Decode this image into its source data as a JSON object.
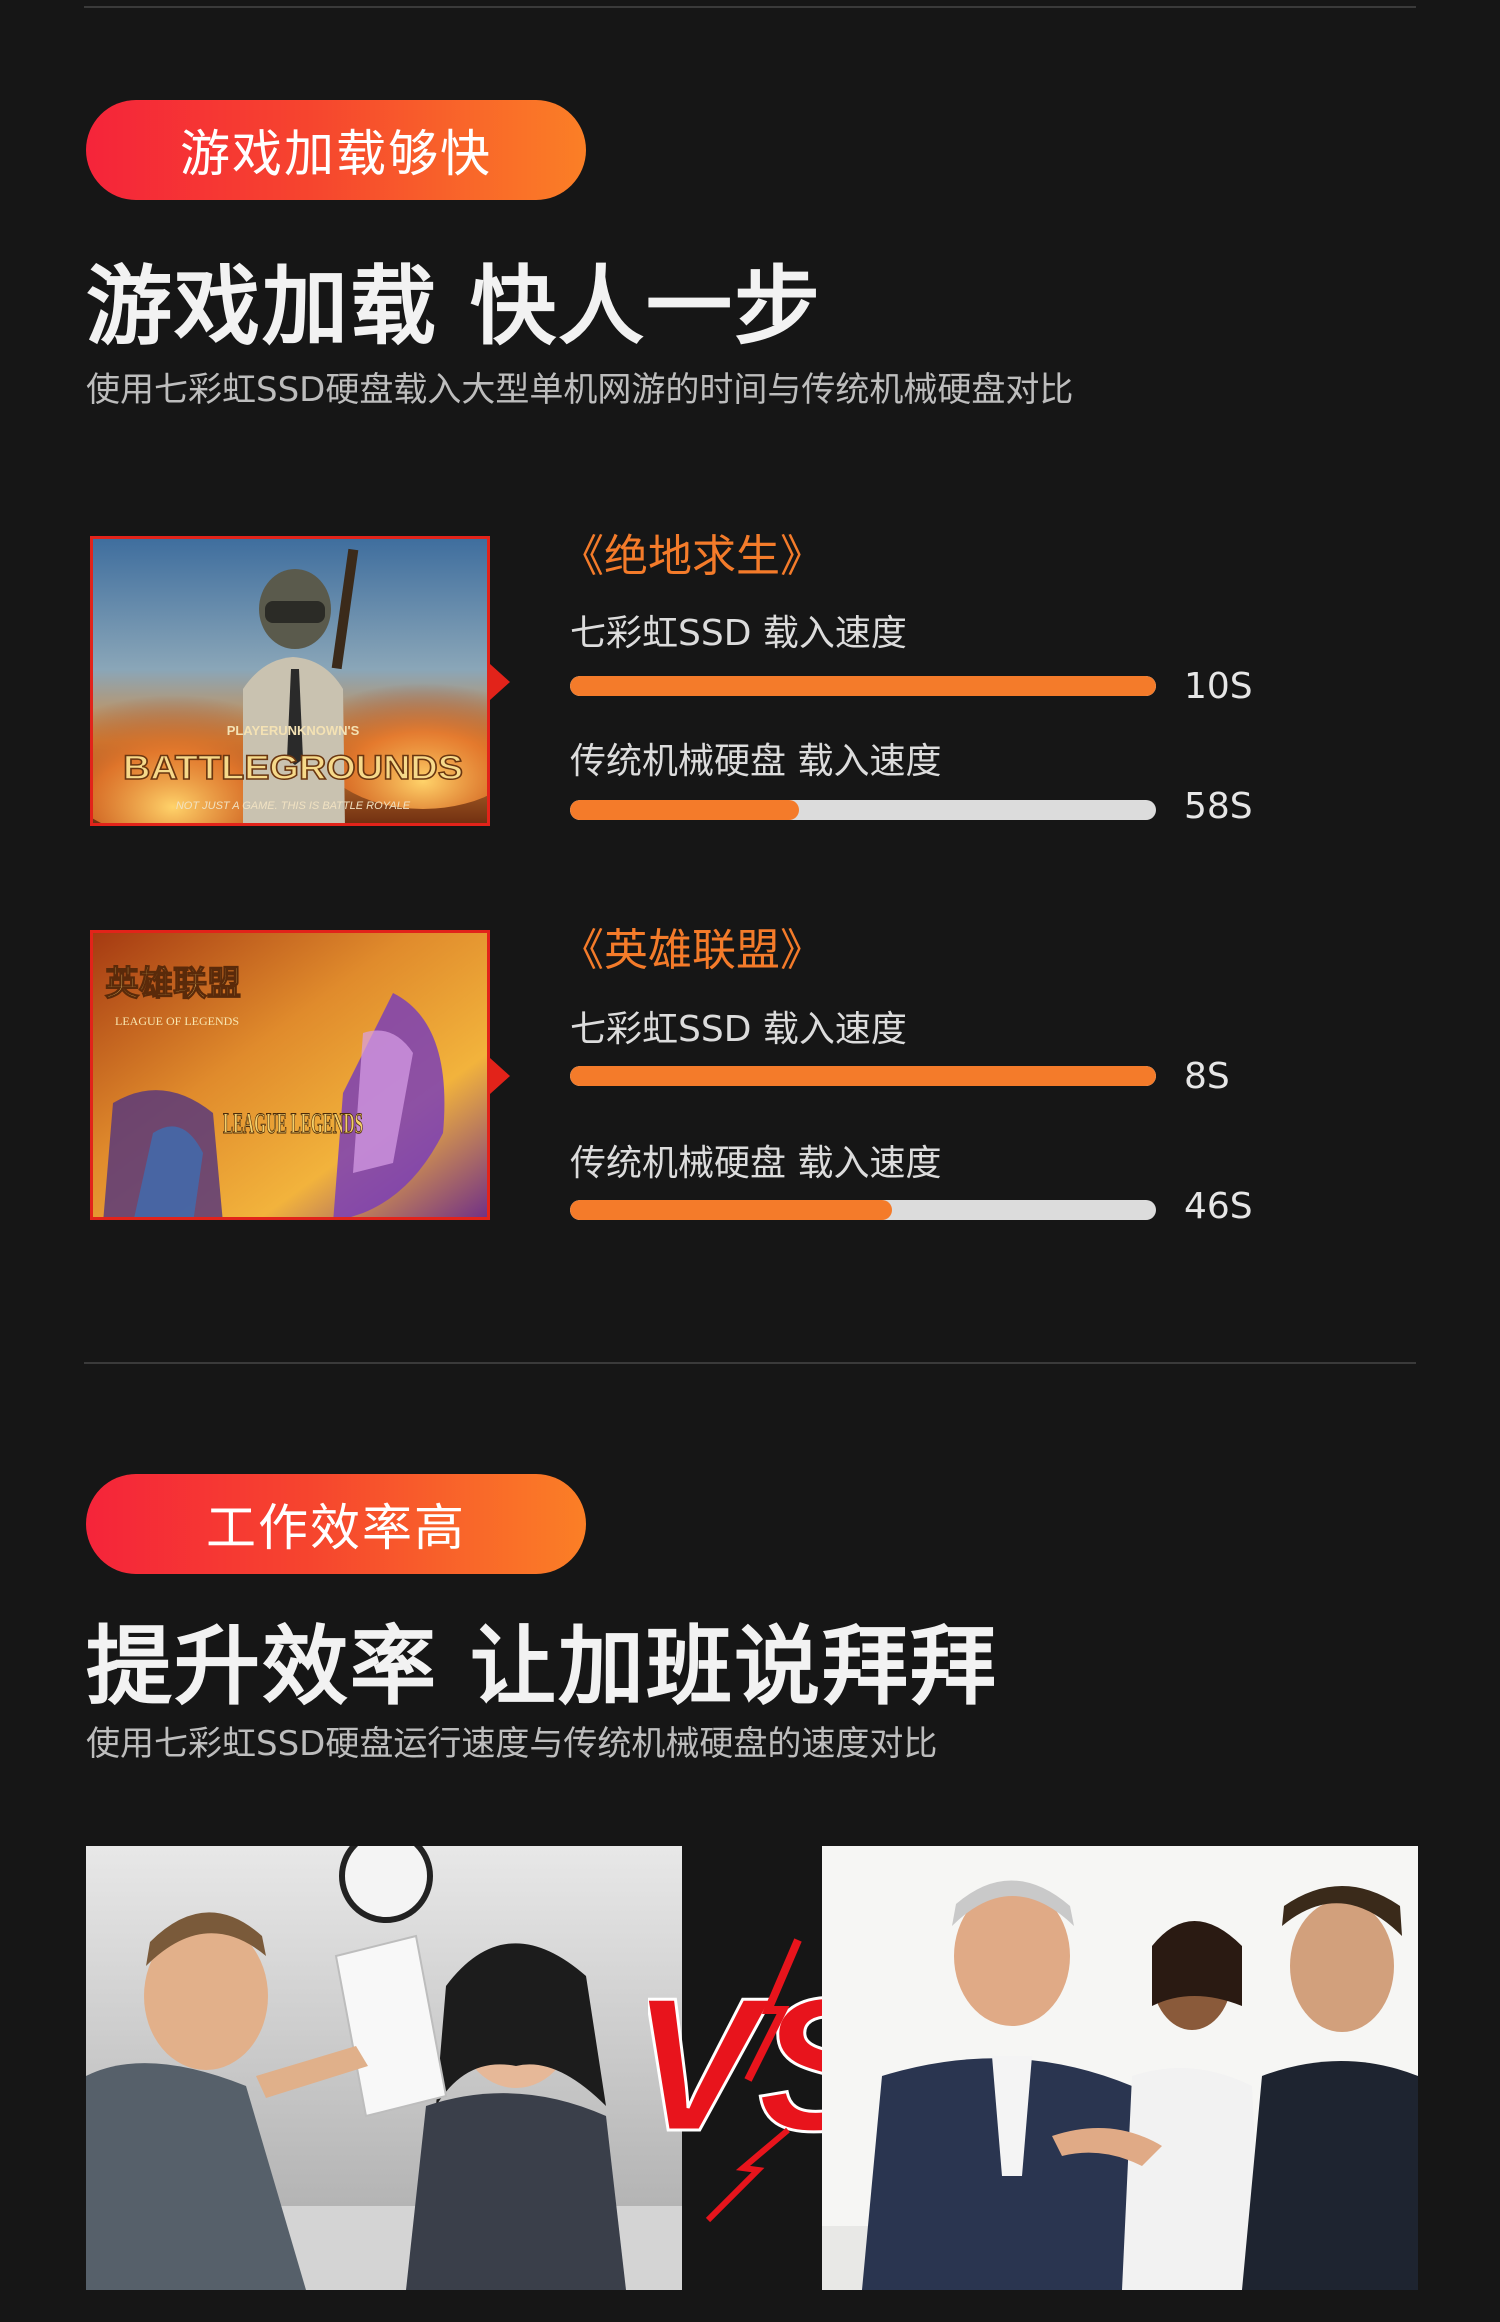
{
  "section1": {
    "badge": "游戏加载够快",
    "headline": "游戏加载 快人一步",
    "subtitle": "使用七彩虹SSD硬盘载入大型单机网游的时间与传统机械硬盘对比"
  },
  "games": [
    {
      "title": "《绝地求生》",
      "thumb_text_top": "PLAYERUNKNOWN'S",
      "thumb_text_main": "BATTLEGROUNDS",
      "thumb_text_sub": "NOT JUST A GAME. THIS IS BATTLE ROYALE",
      "ssd_label": "七彩虹SSD 载入速度",
      "ssd_value": "10S",
      "ssd_fill": 1.0,
      "hdd_label": "传统机械硬盘 载入速度",
      "hdd_value": "58S",
      "hdd_fill": 0.39
    },
    {
      "title": "《英雄联盟》",
      "thumb_text_top": "英雄联盟",
      "thumb_text_sub": "LEAGUE OF LEGENDS",
      "thumb_text_main": "LEAGUE LEGENDS",
      "ssd_label": "七彩虹SSD 载入速度",
      "ssd_value": "8S",
      "ssd_fill": 1.0,
      "hdd_label": "传统机械硬盘 载入速度",
      "hdd_value": "46S",
      "hdd_fill": 0.55
    }
  ],
  "section2": {
    "badge": "工作效率高",
    "headline": "提升效率 让加班说拜拜",
    "subtitle": "使用七彩虹SSD硬盘运行速度与传统机械硬盘的速度对比"
  },
  "comparison": {
    "vs_text": "VS"
  },
  "colors": {
    "accent_orange": "#f47b2a",
    "accent_red": "#e2231a",
    "background": "#161616"
  }
}
